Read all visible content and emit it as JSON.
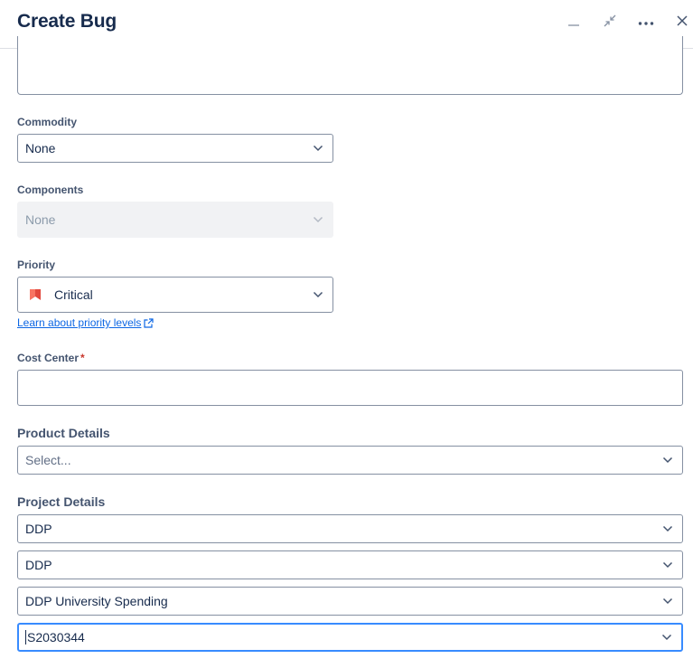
{
  "header": {
    "title": "Create Bug"
  },
  "fields": {
    "commodity": {
      "label": "Commodity",
      "value": "None"
    },
    "components": {
      "label": "Components",
      "value": "None"
    },
    "priority": {
      "label": "Priority",
      "value": "Critical",
      "color": "#e2483d",
      "link_text": "Learn about priority levels"
    },
    "cost_center": {
      "label": "Cost Center",
      "required_mark": "*",
      "value": ""
    },
    "product_details": {
      "label": "Product Details",
      "placeholder": "Select..."
    },
    "project_details": {
      "label": "Project Details",
      "selects": [
        "DDP",
        "DDP",
        "DDP University Spending",
        "S2030344"
      ]
    }
  },
  "colors": {
    "accent": "#388bff",
    "link": "#0c66e4",
    "required": "#c9372c",
    "border": "#8590a2"
  },
  "icons": {
    "minimize": "minimize-icon",
    "collapse": "collapse-icon",
    "more": "more-icon",
    "close": "close-icon",
    "chevron": "chevron-down-icon",
    "priority": "priority-critical-icon",
    "external": "external-link-icon"
  }
}
